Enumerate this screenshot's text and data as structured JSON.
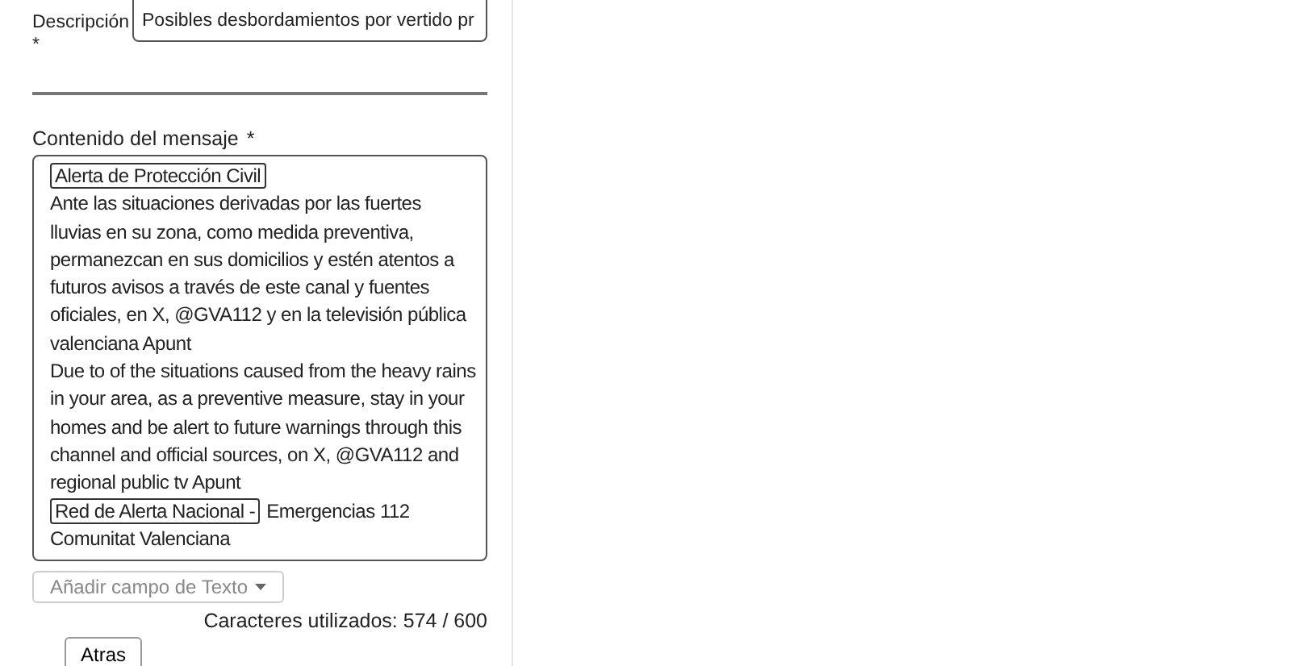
{
  "description": {
    "label": "Descripción",
    "required": "*",
    "value": "Posibles desbordamientos por vertido pr"
  },
  "message": {
    "label": "Contenido del mensaje",
    "required": "*",
    "paragraphs": [
      [
        {
          "kind": "chip",
          "text": "Alerta de Protección Civil"
        }
      ],
      [
        {
          "kind": "text",
          "text": "Ante las situaciones derivadas por las fuertes lluvias en su zona, como medida preventiva, permanezcan en sus domicilios y estén atentos a futuros avisos a través de este canal y fuentes oficiales, en X, @GVA112 y en la televisión pública valenciana Apunt"
        }
      ],
      [
        {
          "kind": "text",
          "text": "Due to of the situations caused from the heavy rains in your area, as a preventive measure, stay in your homes and be alert to future warnings through this channel and official sources,  on X, @GVA112 and regional public tv Apunt"
        }
      ],
      [
        {
          "kind": "chip",
          "text": "Red de Alerta Nacional -"
        },
        {
          "kind": "text",
          "text": "Emergencias 112"
        }
      ],
      [
        {
          "kind": "text",
          "text": "Comunitat Valenciana"
        }
      ]
    ]
  },
  "add_field": {
    "placeholder": "Añadir campo de Texto"
  },
  "char_count": "Caracteres utilizados: 574 / 600",
  "back_button": "Atras"
}
